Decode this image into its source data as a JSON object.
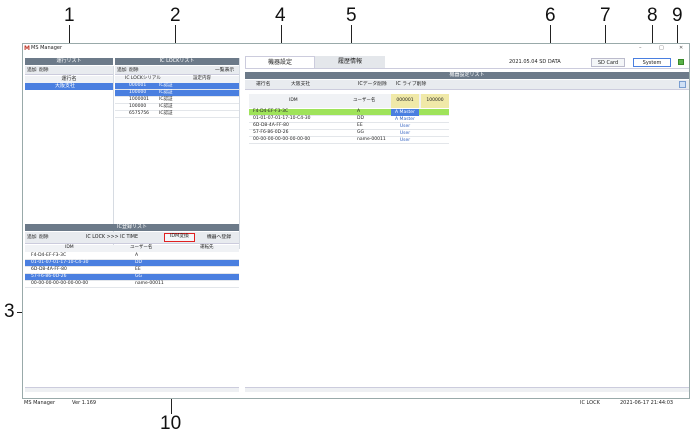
{
  "callouts": {
    "c1": "1",
    "c2": "2",
    "c3": "3",
    "c4": "4",
    "c5": "5",
    "c6": "6",
    "c7": "7",
    "c8": "8",
    "c9": "9",
    "c10": "10"
  },
  "app": {
    "logo": "M",
    "title": "MS Manager",
    "window_controls": [
      "–",
      "□",
      "✕"
    ]
  },
  "left_top_panel": {
    "header": "運行リスト",
    "toolbar": {
      "add": "追加",
      "delete": "削除"
    },
    "col": "運行名",
    "rows": [
      "大阪支社"
    ]
  },
  "ic_lock_panel": {
    "header": "IC LOCKリスト",
    "toolbar": {
      "add": "追加",
      "delete": "削除",
      "list_view": "一覧表示"
    },
    "cols": [
      "IC LOCKシリアル",
      "設定内容"
    ],
    "rows": [
      {
        "serial": "000001",
        "setting": "IC認証",
        "selected": true
      },
      {
        "serial": "100000",
        "setting": "IC認証",
        "selected": true
      },
      {
        "serial": "1000001",
        "setting": "IC認証",
        "selected": false
      },
      {
        "serial": "100000",
        "setting": "IC認証",
        "selected": false
      },
      {
        "serial": "6575756",
        "setting": "IC認証",
        "selected": false
      }
    ]
  },
  "ic_register_panel": {
    "header": "IC登録リスト",
    "toolbar": {
      "add": "追加",
      "delete": "削除",
      "ic_lock_time": "IC LOCK >>> IC TIME",
      "idm_convert": "IDM変換",
      "register_device": "機器へ登録"
    },
    "cols": [
      "IDM",
      "ユーザー名",
      "運転先"
    ],
    "rows": [
      {
        "idm": "F4-D4-EF-F3-3C",
        "user": "A",
        "selected": false
      },
      {
        "idm": "01-01-07-01-17-10-C4-30",
        "user": "DD",
        "selected": true
      },
      {
        "idm": "6D-D8-4A-FF-80",
        "user": "EE",
        "selected": false
      },
      {
        "idm": "57-F6-86-0D-26",
        "user": "GG",
        "selected": true
      },
      {
        "idm": "00-00-00-00-00-00-00-00",
        "user": "name-00011",
        "selected": false
      }
    ]
  },
  "main_tabs": {
    "device_settings": "機器設定",
    "history": "履歴情報"
  },
  "top_right": {
    "date": "2021.05.04 SD DATA",
    "sd_card": "SD Card",
    "system": "System"
  },
  "device_settings_list": {
    "header": "機器設定リスト",
    "toolbar": {
      "route_label": "運行名",
      "route_value": "大阪支社",
      "ic_data_delete": "ICデータ削除",
      "ic_live_delete": "IC ライブ削除"
    },
    "cols": [
      "IDM",
      "ユーザー名",
      "000001",
      "100000"
    ],
    "rows": [
      {
        "idm": "F4-D4-EF-F3-3C",
        "user": "A",
        "role": "A Master",
        "highlight": true
      },
      {
        "idm": "01-01-07-01-17-10-C4-30",
        "user": "DD",
        "role": "A Master",
        "highlight": false
      },
      {
        "idm": "6D-D8-4A-FF-80",
        "user": "EE",
        "role": "User",
        "highlight": false
      },
      {
        "idm": "57-F6-86-0D-26",
        "user": "GG",
        "role": "User",
        "highlight": false
      },
      {
        "idm": "00-00-00-00-00-00-00-00",
        "user": "name-00011",
        "role": "User",
        "highlight": false
      }
    ]
  },
  "status_bar": {
    "app": "MS Manager",
    "version": "Ver 1.169",
    "lock": "IC LOCK",
    "datetime": "2021-06-17 21:44:03"
  },
  "colors": {
    "header": "#6c7a89",
    "selected": "#4a7fe0",
    "highlight_green": "#9fe35a",
    "accent_yellow": "#f0e9a8",
    "callout_red": "#e02020"
  }
}
